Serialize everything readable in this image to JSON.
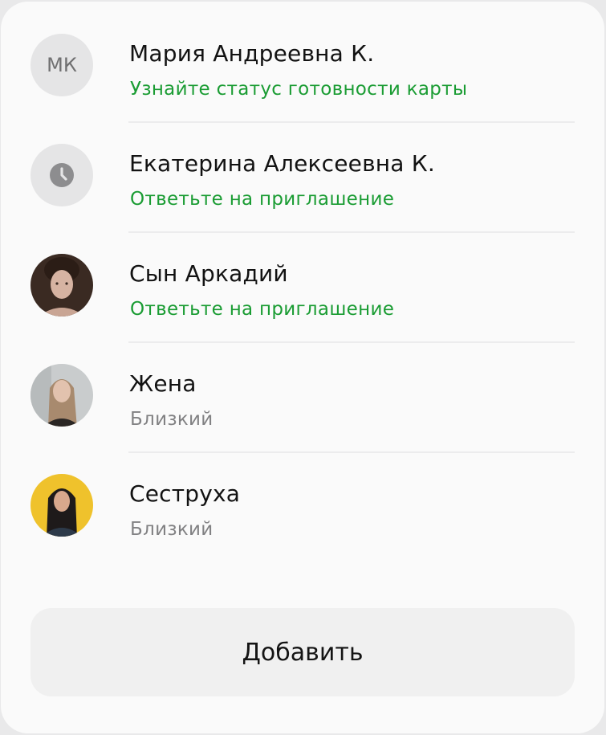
{
  "contacts": [
    {
      "name": "Мария Андреевна К.",
      "status": "Узнайте статус готовности карты",
      "status_tone": "green",
      "avatar_type": "initials",
      "initials": "МК"
    },
    {
      "name": "Екатерина Алексеевна К.",
      "status": "Ответьте на приглашение",
      "status_tone": "green",
      "avatar_type": "clock-icon"
    },
    {
      "name": "Сын Аркадий",
      "status": "Ответьте на приглашение",
      "status_tone": "green",
      "avatar_type": "photo"
    },
    {
      "name": "Жена",
      "status": "Близкий",
      "status_tone": "gray",
      "avatar_type": "photo"
    },
    {
      "name": "Сеструха",
      "status": "Близкий",
      "status_tone": "gray",
      "avatar_type": "photo"
    }
  ],
  "add_button": {
    "label": "Добавить"
  },
  "colors": {
    "status_green": "#1a9c33",
    "status_gray": "#818183",
    "card_background": "#fafafa",
    "button_background": "#f0f0f0",
    "avatar_placeholder": "#e5e5e6"
  }
}
